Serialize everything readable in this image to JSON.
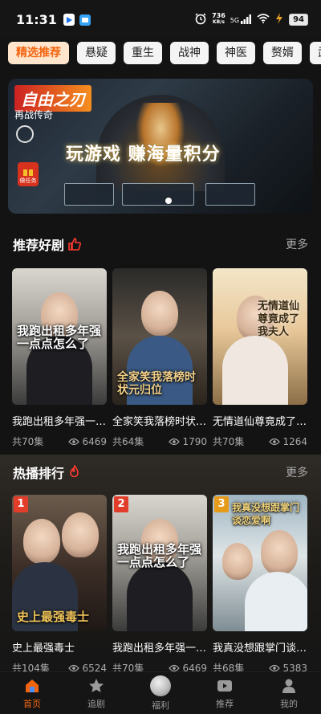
{
  "status_bar": {
    "time": "11:31",
    "net_speed_value": "736",
    "net_speed_unit": "KB/s",
    "network": "5G",
    "battery": "94"
  },
  "tabs": [
    {
      "label": "精选推荐",
      "active": true
    },
    {
      "label": "悬疑"
    },
    {
      "label": "重生"
    },
    {
      "label": "战神"
    },
    {
      "label": "神医"
    },
    {
      "label": "赘婿"
    },
    {
      "label": "武侠"
    }
  ],
  "banner": {
    "logo_text": "自由之刃",
    "subtitle": "再战传奇",
    "slogan": "玩游戏  赚海量积分",
    "badge_text": "做任务"
  },
  "recommended": {
    "title": "推荐好剧",
    "more": "更多",
    "items": [
      {
        "title": "我跑出租多年强一点点怎么了",
        "poster_text": "我跑出租多年强一点点怎么了",
        "episodes": "共70集",
        "views": "6469"
      },
      {
        "title": "全家笑我落榜时状元归位",
        "poster_text": "全家笑我落榜时状元归位",
        "episodes": "共64集",
        "views": "1790"
      },
      {
        "title": "无情道仙尊竟成了我夫人",
        "poster_text": "无情道仙尊竟成了我夫人",
        "episodes": "共70集",
        "views": "1264"
      }
    ]
  },
  "hot": {
    "title": "热播排行",
    "more": "更多",
    "items": [
      {
        "rank": "1",
        "title": "史上最强毒士",
        "poster_text": "史上最强毒士",
        "episodes": "共104集",
        "views": "6524"
      },
      {
        "rank": "2",
        "title": "我跑出租多年强一点点怎么了",
        "poster_text": "我跑出租多年强一点点怎么了",
        "episodes": "共70集",
        "views": "6469"
      },
      {
        "rank": "3",
        "title": "我真没想跟掌门谈恋爱啊",
        "poster_text": "我真没想跟掌门谈恋爱啊",
        "episodes": "共68集",
        "views": "5383"
      }
    ]
  },
  "bottom_nav": [
    {
      "label": "首页",
      "icon": "home-icon",
      "active": true
    },
    {
      "label": "追剧",
      "icon": "star-icon"
    },
    {
      "label": "福利",
      "icon": "welfare-icon"
    },
    {
      "label": "推荐",
      "icon": "play-icon"
    },
    {
      "label": "我的",
      "icon": "profile-icon"
    }
  ],
  "colors": {
    "accent": "#f26510",
    "rank_red": "#e23d2a",
    "rank_orange": "#e69b1a"
  }
}
